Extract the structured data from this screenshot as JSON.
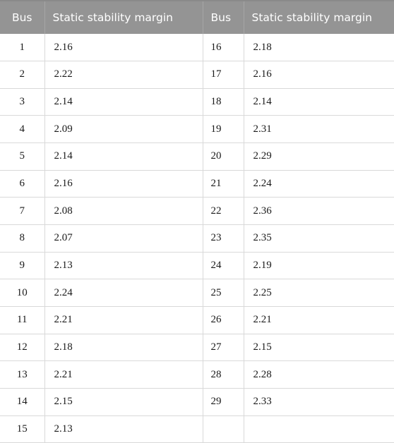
{
  "table": {
    "headers": {
      "bus_left": "Bus",
      "value_left": "Static stability margin",
      "bus_right": "Bus",
      "value_right": "Static stability margin"
    },
    "colors": {
      "header_background": "#949494",
      "header_text": "#ffffff",
      "header_divider": "#a6a6a6",
      "header_top_border": "#8a8a8a",
      "body_background": "#ffffff",
      "body_text": "#1a1a1a",
      "body_divider": "#d9d9d9"
    },
    "rows": [
      {
        "bus_left": "1",
        "value_left": "2.16",
        "bus_right": "16",
        "value_right": "2.18"
      },
      {
        "bus_left": "2",
        "value_left": "2.22",
        "bus_right": "17",
        "value_right": "2.16"
      },
      {
        "bus_left": "3",
        "value_left": "2.14",
        "bus_right": "18",
        "value_right": "2.14"
      },
      {
        "bus_left": "4",
        "value_left": "2.09",
        "bus_right": "19",
        "value_right": "2.31"
      },
      {
        "bus_left": "5",
        "value_left": "2.14",
        "bus_right": "20",
        "value_right": "2.29"
      },
      {
        "bus_left": "6",
        "value_left": "2.16",
        "bus_right": "21",
        "value_right": "2.24"
      },
      {
        "bus_left": "7",
        "value_left": "2.08",
        "bus_right": "22",
        "value_right": "2.36"
      },
      {
        "bus_left": "8",
        "value_left": "2.07",
        "bus_right": "23",
        "value_right": "2.35"
      },
      {
        "bus_left": "9",
        "value_left": "2.13",
        "bus_right": "24",
        "value_right": "2.19"
      },
      {
        "bus_left": "10",
        "value_left": "2.24",
        "bus_right": "25",
        "value_right": "2.25"
      },
      {
        "bus_left": "11",
        "value_left": "2.21",
        "bus_right": "26",
        "value_right": "2.21"
      },
      {
        "bus_left": "12",
        "value_left": "2.18",
        "bus_right": "27",
        "value_right": "2.15"
      },
      {
        "bus_left": "13",
        "value_left": "2.21",
        "bus_right": "28",
        "value_right": "2.28"
      },
      {
        "bus_left": "14",
        "value_left": "2.15",
        "bus_right": "29",
        "value_right": "2.33"
      },
      {
        "bus_left": "15",
        "value_left": "2.13",
        "bus_right": "",
        "value_right": ""
      }
    ]
  }
}
